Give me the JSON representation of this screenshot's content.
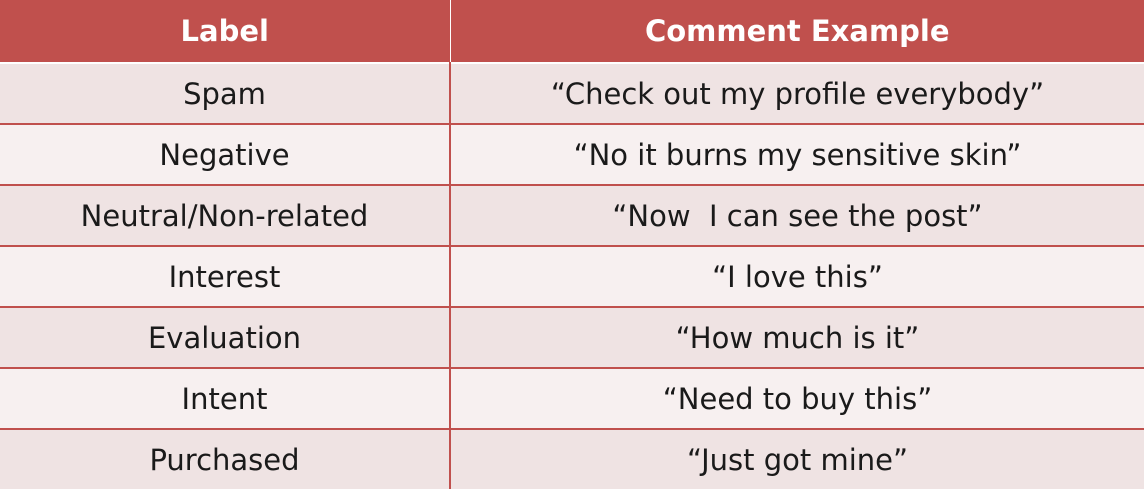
{
  "table": {
    "headers": [
      "Label",
      "Comment Example"
    ],
    "rows": [
      [
        "Spam",
        "“Check out my profile everybody”"
      ],
      [
        "Negative",
        "“No it burns my sensitive skin”"
      ],
      [
        "Neutral/Non-related",
        "“Now  I can see the post”"
      ],
      [
        "Interest",
        "“I love this”"
      ],
      [
        "Evaluation",
        "“How much is it”"
      ],
      [
        "Intent",
        "“Need to buy this”"
      ],
      [
        "Purchased",
        "“Just got mine”"
      ]
    ]
  },
  "colors": {
    "header_bg": "#c0504d",
    "header_text": "#ffffff",
    "row_odd": "#efe3e3",
    "row_even": "#f7f0f0",
    "grid": "#c0504d"
  }
}
